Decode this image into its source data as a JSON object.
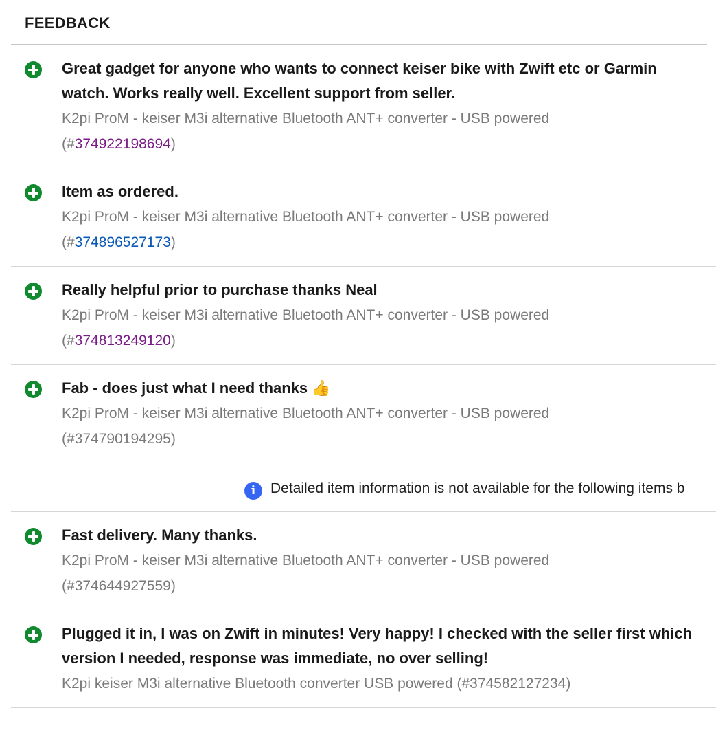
{
  "header": {
    "title": "FEEDBACK"
  },
  "feedback": [
    {
      "comment": "Great gadget for anyone who wants to connect keiser bike with Zwift etc or Garmin watch. Works really well. Excellent support from seller.",
      "item_title": "K2pi ProM - keiser M3i alternative Bluetooth ANT+ converter - USB powered",
      "item_id": "374922198694"
    },
    {
      "comment": "Item as ordered.",
      "item_title": "K2pi ProM - keiser M3i alternative Bluetooth ANT+ converter - USB powered",
      "item_id": "374896527173"
    },
    {
      "comment": "Really helpful prior to purchase thanks Neal",
      "item_title": "K2pi ProM - keiser M3i alternative Bluetooth ANT+ converter - USB powered",
      "item_id": "374813249120"
    },
    {
      "comment": "Fab - does just what I need thanks",
      "comment_emoji": "👍",
      "item_title": "K2pi ProM - keiser M3i alternative Bluetooth ANT+ converter - USB powered",
      "item_id": "374790194295"
    },
    {
      "comment": "Fast delivery. Many thanks.",
      "item_title": "K2pi ProM - keiser M3i alternative Bluetooth ANT+ converter - USB powered",
      "item_id": "374644927559"
    },
    {
      "comment": "Plugged it in, I was on Zwift in minutes! Very happy! I checked with the seller first which version I needed, response was immediate, no over selling!",
      "item_title": "K2pi keiser M3i alternative Bluetooth converter USB powered",
      "item_id": "374582127234"
    }
  ],
  "notice": {
    "text": "Detailed item information is not available for the following items b",
    "icon": "info-icon"
  },
  "id_prefix": "(#",
  "id_suffix": ")",
  "colors": {
    "positive": "#118a2f",
    "visited_link": "#7b1b88",
    "link": "#0a58b8",
    "muted": "#7a7a7a",
    "info": "#3665f3"
  }
}
